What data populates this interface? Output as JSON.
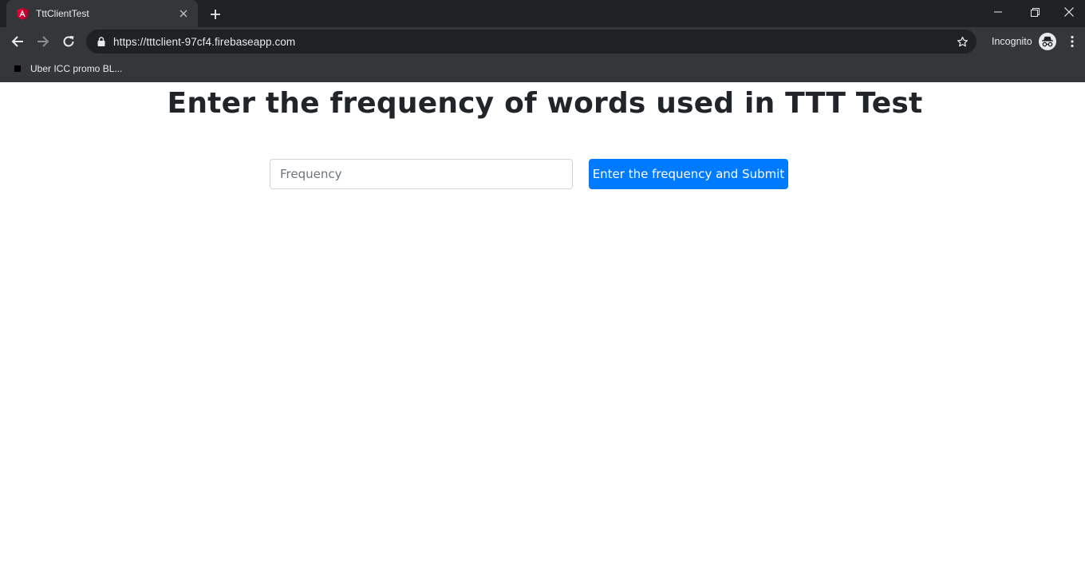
{
  "browser": {
    "tab": {
      "title": "TttClientTest",
      "favicon": "angular-icon"
    },
    "url": "https://tttclient-97cf4.firebaseapp.com",
    "incognito_label": "Incognito",
    "bookmarks": [
      {
        "label": "Uber ICC promo BL..."
      }
    ]
  },
  "page": {
    "heading": "Enter the frequency of words used in TTT Test",
    "input": {
      "placeholder": "Frequency",
      "value": ""
    },
    "submit_label": "Enter the frequency and Submit"
  },
  "colors": {
    "chrome_bg": "#202124",
    "toolbar_bg": "#35363a",
    "button_primary": "#007bff",
    "heading_text": "#212529",
    "favicon_red": "#dd0031"
  }
}
